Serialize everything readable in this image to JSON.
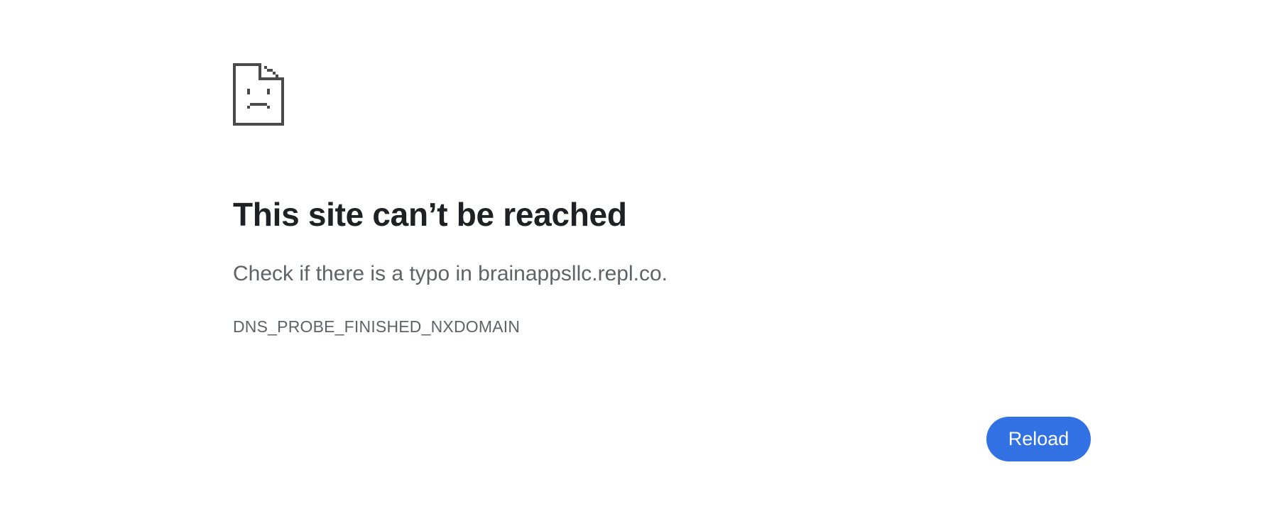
{
  "error_page": {
    "icon": "sad-document-icon",
    "title": "This site can’t be reached",
    "summary": "Check if there is a typo in brainappsllc.repl.co.",
    "error_code": "DNS_PROBE_FINISHED_NXDOMAIN",
    "reload_label": "Reload"
  },
  "colors": {
    "title": "#202124",
    "secondary_text": "#5f6368",
    "icon": "#4a4a4a",
    "button_background": "#3271e3",
    "button_text": "#ffffff",
    "background": "#ffffff"
  }
}
